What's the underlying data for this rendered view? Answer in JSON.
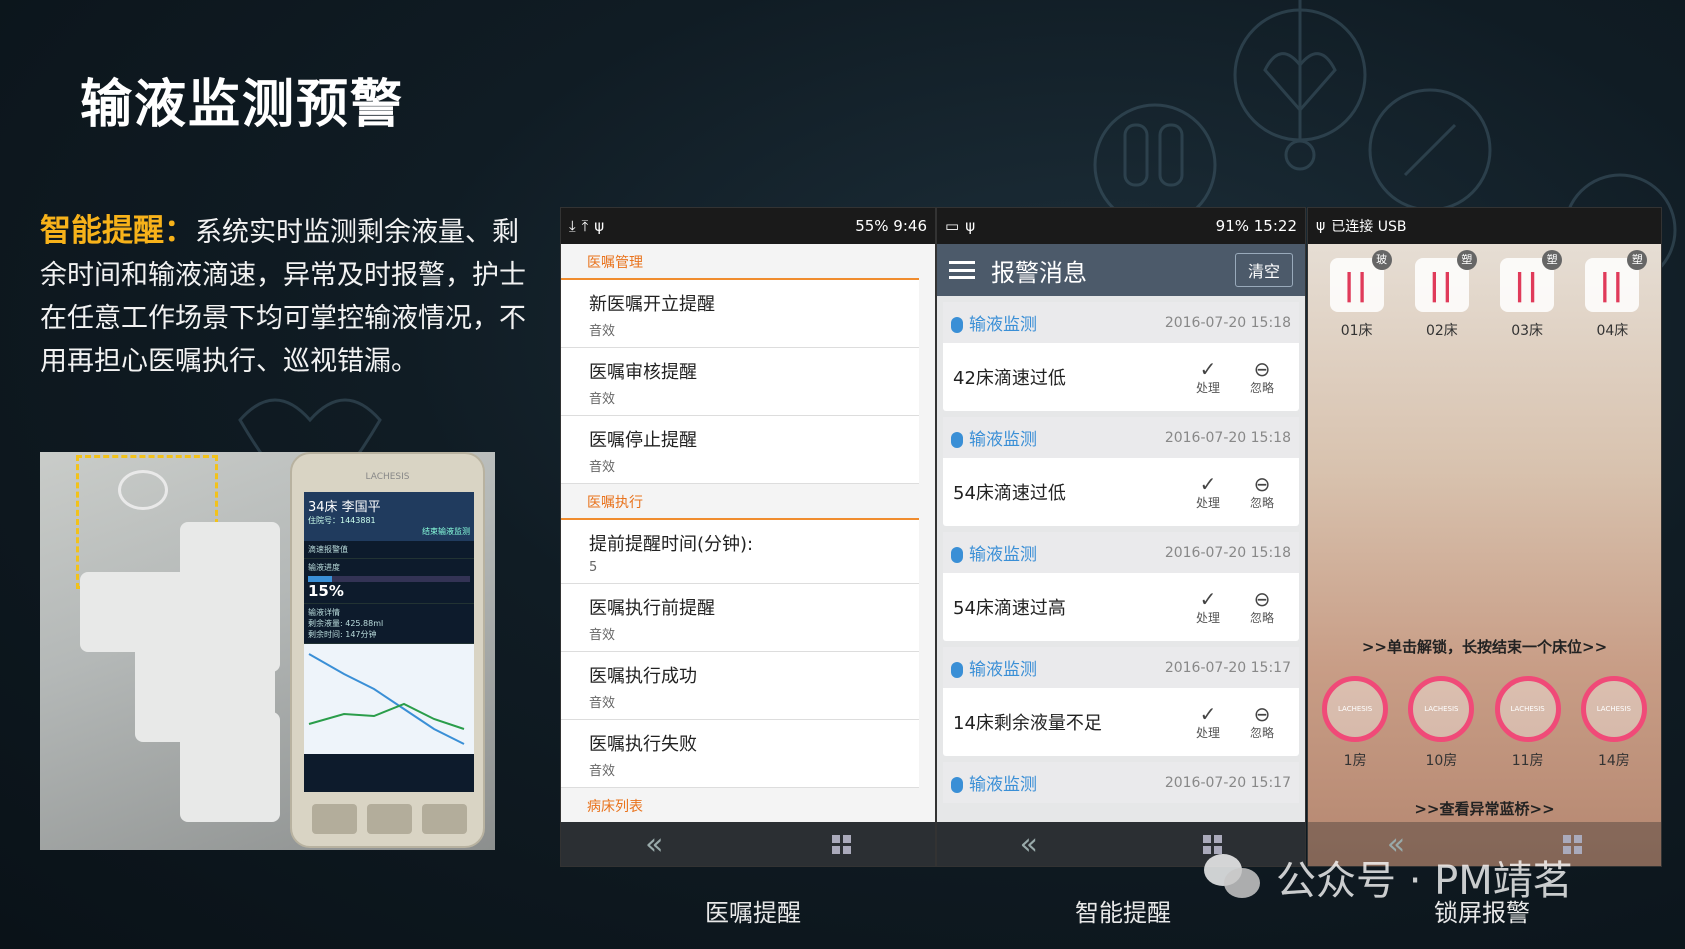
{
  "title": "输液监测预警",
  "description": {
    "highlight": "智能提醒：",
    "text": "系统实时监测剩余液量、剩余时间和输液滴速，异常及时报警，护士在任意工作场景下均可掌控输液情况，不用再担心医嘱执行、巡视错漏。"
  },
  "device_photo": {
    "brand": "LACHESIS",
    "bed": "34床 李国平",
    "patient_id": "住院号：1443881",
    "button": "结束输液监测",
    "drip_alert": "滴速报警值",
    "progress_label": "输液进度",
    "progress_value": "15%",
    "progress": 0.15,
    "detail_label": "输液详情",
    "remaining": "剩余液量: 425.88ml",
    "remaining_time": "剩余时间: 147分钟"
  },
  "screen1": {
    "status": "55% 9:46",
    "sections": [
      {
        "header": "医嘱管理",
        "items": [
          {
            "title": "新医嘱开立提醒",
            "sub": "音效"
          },
          {
            "title": "医嘱审核提醒",
            "sub": "音效"
          },
          {
            "title": "医嘱停止提醒",
            "sub": "音效"
          }
        ]
      },
      {
        "header": "医嘱执行",
        "items": [
          {
            "title": "提前提醒时间(分钟):",
            "sub": "5"
          },
          {
            "title": "医嘱执行前提醒",
            "sub": "音效"
          },
          {
            "title": "医嘱执行成功",
            "sub": "音效"
          },
          {
            "title": "医嘱执行失败",
            "sub": "音效"
          }
        ]
      },
      {
        "header": "病床列表",
        "items": []
      }
    ]
  },
  "screen2": {
    "status": "91% 15:22",
    "title": "报警消息",
    "clear": "清空",
    "alerts": [
      {
        "type": "输液监测",
        "time": "2016-07-20 15:18",
        "msg": "42床滴速过低"
      },
      {
        "type": "输液监测",
        "time": "2016-07-20 15:18",
        "msg": "54床滴速过低"
      },
      {
        "type": "输液监测",
        "time": "2016-07-20 15:18",
        "msg": "54床滴速过高"
      },
      {
        "type": "输液监测",
        "time": "2016-07-20 15:17",
        "msg": "14床剩余液量不足"
      },
      {
        "type": "输液监测",
        "time": "2016-07-20 15:17",
        "msg": ""
      }
    ],
    "handle": "处理",
    "ignore": "忽略"
  },
  "screen3": {
    "status": "已连接 USB",
    "beds": [
      {
        "label": "01床",
        "tag": "玻"
      },
      {
        "label": "02床",
        "tag": "塑"
      },
      {
        "label": "03床",
        "tag": "塑"
      },
      {
        "label": "04床",
        "tag": "塑"
      }
    ],
    "hint_unlock": ">>单击解锁，长按结束一个床位>>",
    "rooms": [
      "1房",
      "10房",
      "11房",
      "14房"
    ],
    "ring_brand": "LACHESIS",
    "hint_bridge": ">>查看异常蓝桥>>"
  },
  "captions": [
    "医嘱提醒",
    "智能提醒",
    "锁屏报警"
  ],
  "watermark": "公众号 · PM靖茗",
  "colors": {
    "accent": "#f7b21a",
    "section": "#e9731d",
    "link": "#3a8fd6",
    "alarm": "#f04a78"
  }
}
